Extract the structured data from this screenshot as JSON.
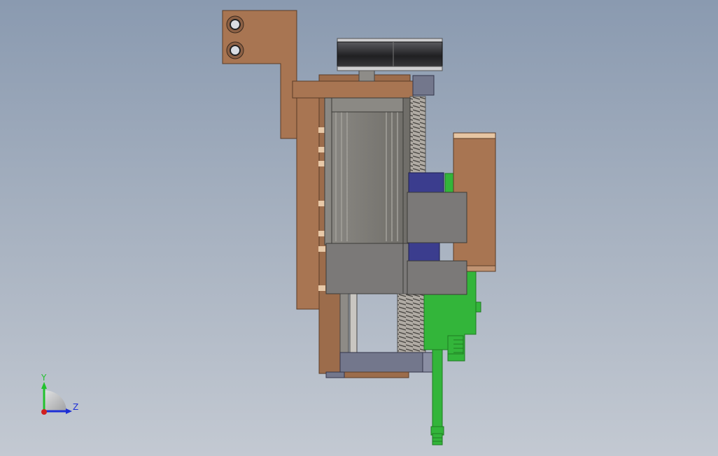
{
  "viewport": {
    "background_top": "#8a9ab0",
    "background_bottom": "#c3c9d2"
  },
  "triad": {
    "y_label": "Y",
    "z_label": "Z",
    "y_color": "#22c22e",
    "z_color": "#1d2fd6",
    "x_color": "#d11f1f"
  },
  "colors": {
    "copper": "#a87552",
    "copper_dark": "#6e4a31",
    "motor_gray": "#7c7a75",
    "motor_dark": "#5a5955",
    "block_gray": "#7b7978",
    "slate": "#73778c",
    "pulley_black": "#2b2b2d",
    "navy": "#3b3d8e",
    "green": "#33b53a",
    "green_dark": "#1f7a22",
    "spring": "#8f8a84"
  }
}
